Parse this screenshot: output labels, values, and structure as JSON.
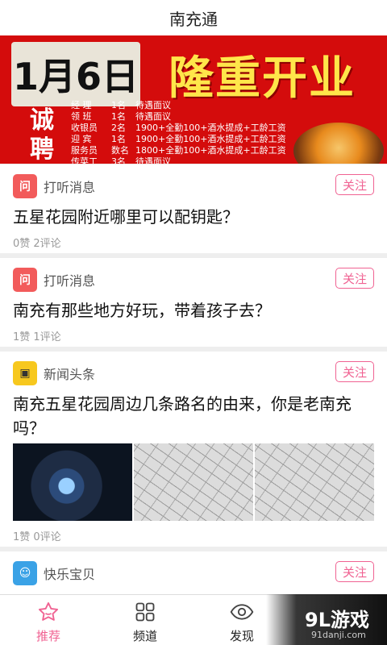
{
  "app": {
    "title": "南充通"
  },
  "banner": {
    "date": "1月6日",
    "headline": "隆重开业",
    "hire": "诚聘",
    "jobs": [
      [
        "经 理",
        "1名",
        "待遇面议"
      ],
      [
        "领 班",
        "1名",
        "待遇面议"
      ],
      [
        "收银员",
        "2名",
        "1900+全勤100+酒水提成+工龄工资"
      ],
      [
        "迎 宾",
        "1名",
        "1900+全勤100+酒水提成+工龄工资"
      ],
      [
        "服务员",
        "数名",
        "1800+全勤100+酒水提成+工龄工资"
      ],
      [
        "传菜工",
        "3名",
        "待遇面议"
      ]
    ]
  },
  "follow_label": "关注",
  "posts": [
    {
      "source": "打听消息",
      "logo_text": "问",
      "text": "五星花园附近哪里可以配钥匙？",
      "meta": "0赞 2评论"
    },
    {
      "source": "打听消息",
      "logo_text": "问",
      "text": "南充有那些地方好玩，带着孩子去？",
      "meta": "1赞 1评论"
    },
    {
      "source": "新闻头条",
      "logo_text": "▣",
      "text": "南充五星花园周边几条路名的由来，你是老南充吗？",
      "meta": "1赞 0评论"
    },
    {
      "source": "快乐宝贝",
      "logo_text": "☺"
    }
  ],
  "tabs": [
    {
      "label": "推荐",
      "icon": "star-icon"
    },
    {
      "label": "频道",
      "icon": "grid-icon"
    },
    {
      "label": "发现",
      "icon": "eye-icon"
    }
  ],
  "watermark": {
    "main": "9L游戏",
    "sub": "91danji.com"
  },
  "colors": {
    "accent": "#f06292",
    "banner_red": "#d40c0c"
  }
}
